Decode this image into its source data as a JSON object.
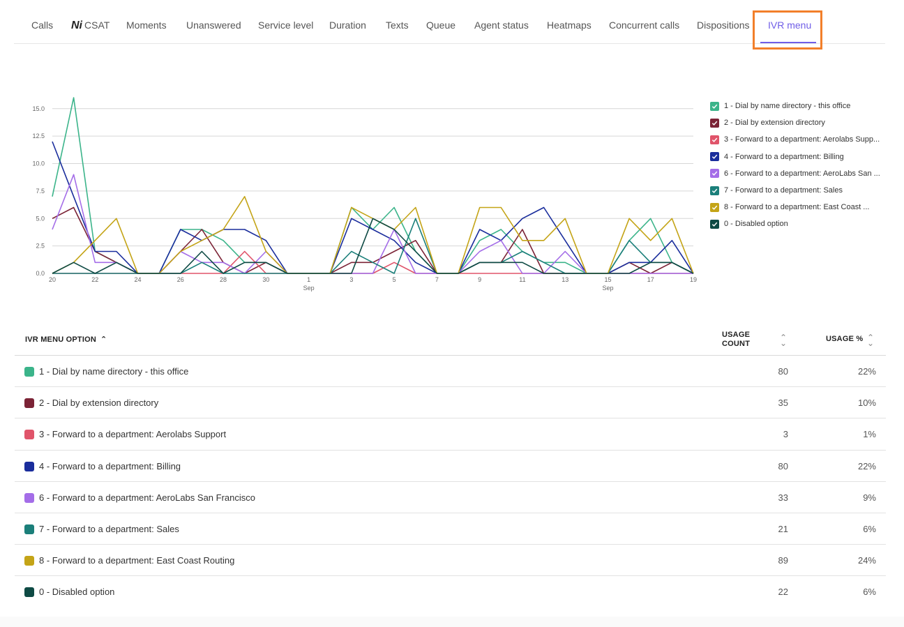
{
  "tabs": [
    {
      "label": "Calls"
    },
    {
      "label": "CSAT",
      "icon": "ai-icon"
    },
    {
      "label": "Moments"
    },
    {
      "label": "Unanswered"
    },
    {
      "label": "Service level"
    },
    {
      "label": "Duration"
    },
    {
      "label": "Texts"
    },
    {
      "label": "Queue"
    },
    {
      "label": "Agent status"
    },
    {
      "label": "Heatmaps"
    },
    {
      "label": "Concurrent calls"
    },
    {
      "label": "Dispositions"
    },
    {
      "label": "IVR menu",
      "active": true
    }
  ],
  "ai_mark": "Ni",
  "colors": {
    "accent": "#6f5de7",
    "highlight": "#f27f2a"
  },
  "legend": [
    {
      "label": "1 - Dial by name directory - this office",
      "color": "#3bb48a"
    },
    {
      "label": "2 - Dial by extension directory",
      "color": "#7b2336"
    },
    {
      "label": "3 - Forward to a department: Aerolabs Supp...",
      "color": "#e0546a"
    },
    {
      "label": "4 - Forward to a department: Billing",
      "color": "#1a2d9c"
    },
    {
      "label": "6 - Forward to a department: AeroLabs San ...",
      "color": "#a46de8"
    },
    {
      "label": "7 - Forward to a department: Sales",
      "color": "#1b7f7a"
    },
    {
      "label": "8 - Forward to a department: East Coast ...",
      "color": "#c4a417"
    },
    {
      "label": "0 - Disabled option",
      "color": "#0e4a44"
    }
  ],
  "chart_data": {
    "type": "line",
    "y_ticks": [
      "0.0",
      "2.5",
      "5.0",
      "7.5",
      "10.0",
      "12.5",
      "15.0"
    ],
    "ylim": [
      0,
      16
    ],
    "x_tick_labels": [
      {
        "label": "20",
        "sub": ""
      },
      {
        "label": "22",
        "sub": ""
      },
      {
        "label": "24",
        "sub": ""
      },
      {
        "label": "26",
        "sub": ""
      },
      {
        "label": "28",
        "sub": ""
      },
      {
        "label": "30",
        "sub": ""
      },
      {
        "label": "1",
        "sub": "Sep"
      },
      {
        "label": "3",
        "sub": ""
      },
      {
        "label": "5",
        "sub": ""
      },
      {
        "label": "7",
        "sub": ""
      },
      {
        "label": "9",
        "sub": ""
      },
      {
        "label": "11",
        "sub": ""
      },
      {
        "label": "13",
        "sub": ""
      },
      {
        "label": "15",
        "sub": "Sep"
      },
      {
        "label": "17",
        "sub": ""
      },
      {
        "label": "19",
        "sub": ""
      }
    ],
    "x": [
      "Aug 20",
      "Aug 21",
      "Aug 22",
      "Aug 23",
      "Aug 24",
      "Aug 25",
      "Aug 26",
      "Aug 27",
      "Aug 28",
      "Aug 29",
      "Aug 30",
      "Aug 31",
      "Sep 1",
      "Sep 2",
      "Sep 3",
      "Sep 4",
      "Sep 5",
      "Sep 6",
      "Sep 7",
      "Sep 8",
      "Sep 9",
      "Sep 10",
      "Sep 11",
      "Sep 12",
      "Sep 13",
      "Sep 14",
      "Sep 15",
      "Sep 16",
      "Sep 17",
      "Sep 18",
      "Sep 19"
    ],
    "series": [
      {
        "name": "1 - Dial by name directory - this office",
        "color": "#3bb48a",
        "values": [
          7,
          16,
          2,
          1,
          0,
          0,
          4,
          4,
          3,
          1,
          1,
          0,
          0,
          0,
          6,
          4,
          6,
          2,
          0,
          0,
          3,
          4,
          2,
          1,
          1,
          0,
          0,
          3,
          5,
          1,
          0
        ]
      },
      {
        "name": "2 - Dial by extension directory",
        "color": "#7b2336",
        "values": [
          5,
          6,
          2,
          1,
          0,
          0,
          2,
          4,
          1,
          0,
          1,
          0,
          0,
          0,
          1,
          1,
          2,
          3,
          0,
          0,
          1,
          1,
          4,
          0,
          0,
          0,
          0,
          1,
          0,
          1,
          0
        ]
      },
      {
        "name": "3 - Forward to a department: Aerolabs Support",
        "color": "#e0546a",
        "values": [
          0,
          0,
          0,
          0,
          0,
          0,
          0,
          0,
          0,
          2,
          0,
          0,
          0,
          0,
          0,
          0,
          1,
          0,
          0,
          0,
          0,
          0,
          0,
          0,
          0,
          0,
          0,
          0,
          0,
          0,
          0
        ]
      },
      {
        "name": "4 - Forward to a department: Billing",
        "color": "#1a2d9c",
        "values": [
          12,
          7,
          2,
          2,
          0,
          0,
          4,
          3,
          4,
          4,
          3,
          0,
          0,
          0,
          5,
          4,
          3,
          1,
          0,
          0,
          4,
          3,
          5,
          6,
          3,
          0,
          0,
          1,
          1,
          3,
          0
        ]
      },
      {
        "name": "6 - Forward to a department: AeroLabs San Francisco",
        "color": "#a46de8",
        "values": [
          4,
          9,
          1,
          1,
          0,
          0,
          2,
          1,
          1,
          0,
          2,
          0,
          0,
          0,
          0,
          0,
          4,
          0,
          0,
          0,
          2,
          3,
          0,
          0,
          2,
          0,
          0,
          0,
          0,
          0,
          0
        ]
      },
      {
        "name": "7 - Forward to a department: Sales",
        "color": "#1b7f7a",
        "values": [
          0,
          0,
          0,
          0,
          0,
          0,
          0,
          1,
          0,
          0,
          0,
          0,
          0,
          0,
          2,
          1,
          0,
          5,
          0,
          0,
          1,
          1,
          2,
          1,
          0,
          0,
          0,
          3,
          1,
          1,
          0
        ]
      },
      {
        "name": "8 - Forward to a department: East Coast Routing",
        "color": "#c4a417",
        "values": [
          0,
          1,
          3,
          5,
          0,
          0,
          2,
          3,
          4,
          7,
          2,
          0,
          0,
          0,
          6,
          5,
          4,
          6,
          0,
          0,
          6,
          6,
          3,
          3,
          5,
          0,
          0,
          5,
          3,
          5,
          0
        ]
      },
      {
        "name": "0 - Disabled option",
        "color": "#0e4a44",
        "values": [
          0,
          1,
          0,
          1,
          0,
          0,
          0,
          2,
          0,
          1,
          1,
          0,
          0,
          0,
          0,
          5,
          4,
          2,
          0,
          0,
          1,
          1,
          1,
          0,
          0,
          0,
          0,
          0,
          1,
          1,
          0
        ]
      }
    ]
  },
  "table": {
    "headers": {
      "option": "IVR MENU OPTION",
      "count_line1": "USAGE",
      "count_line2": "COUNT",
      "pct": "USAGE %"
    },
    "rows": [
      {
        "label": "1 - Dial by name directory - this office",
        "count": "80",
        "pct": "22%",
        "color": "#3bb48a"
      },
      {
        "label": "2 - Dial by extension directory",
        "count": "35",
        "pct": "10%",
        "color": "#7b2336"
      },
      {
        "label": "3 - Forward to a department: Aerolabs Support",
        "count": "3",
        "pct": "1%",
        "color": "#e0546a"
      },
      {
        "label": "4 - Forward to a department: Billing",
        "count": "80",
        "pct": "22%",
        "color": "#1a2d9c"
      },
      {
        "label": "6 - Forward to a department: AeroLabs San Francisco",
        "count": "33",
        "pct": "9%",
        "color": "#a46de8"
      },
      {
        "label": "7 - Forward to a department: Sales",
        "count": "21",
        "pct": "6%",
        "color": "#1b7f7a"
      },
      {
        "label": "8 - Forward to a department: East Coast Routing",
        "count": "89",
        "pct": "24%",
        "color": "#c4a417"
      },
      {
        "label": "0 - Disabled option",
        "count": "22",
        "pct": "6%",
        "color": "#0e4a44"
      }
    ]
  }
}
